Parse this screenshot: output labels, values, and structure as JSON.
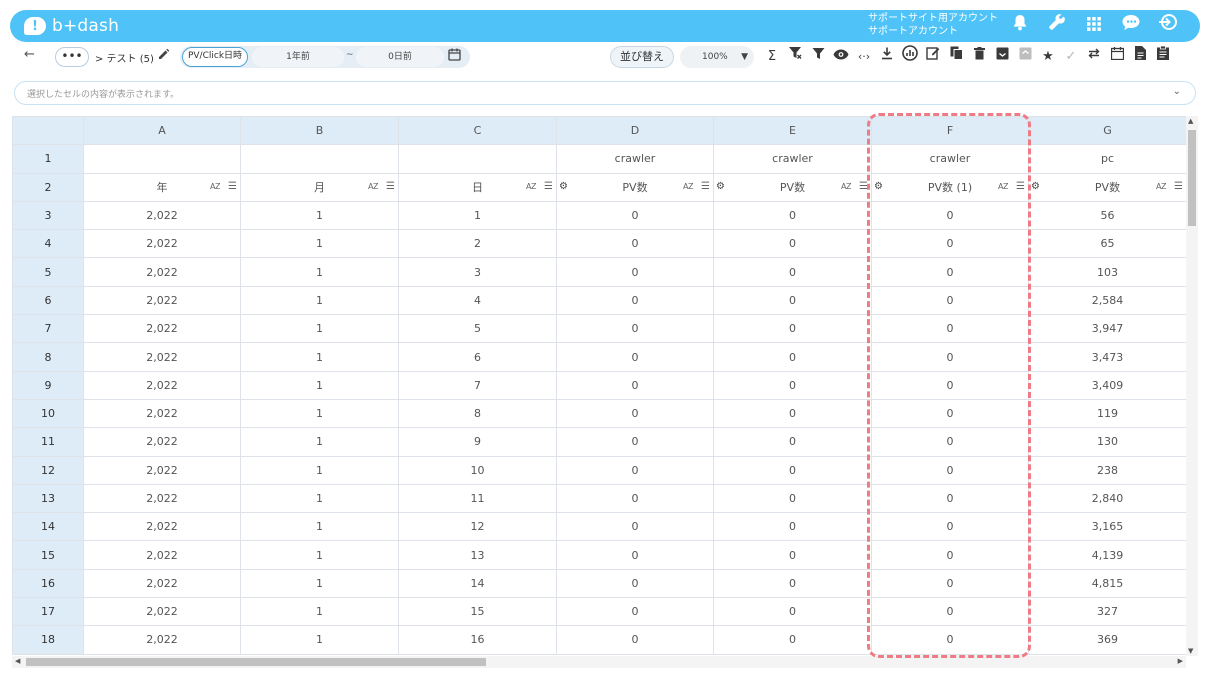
{
  "header": {
    "logo_mark": "!",
    "logo_text": "b+dash",
    "account_line1": "サポートサイト用アカウント",
    "account_line2": "サポートアカウント",
    "icons": [
      "bell-icon",
      "wrench-icon",
      "apps-grid-icon",
      "chat-icon",
      "logout-icon"
    ]
  },
  "toolbar": {
    "back": "←",
    "more": "•••",
    "breadcrumb": "> テスト (5)",
    "date_type": "PV/Click日時",
    "date_from": "1年前",
    "date_sep": "~",
    "date_to": "0日前",
    "sort_label": "並び替え",
    "zoom": "100%",
    "tool_icons": [
      "sum-icon",
      "filter-clear-icon",
      "filter-icon",
      "eye-icon",
      "code-icon",
      "download-icon",
      "chart-icon",
      "edit-note-icon",
      "copy-icon",
      "trash-icon",
      "archive-icon",
      "archive-disabled-icon",
      "star-icon",
      "approve-icon",
      "repeat-icon",
      "calendar-icon",
      "document-icon",
      "clipboard-icon"
    ]
  },
  "cellbar": {
    "placeholder": "選択したセルの内容が表示されます。"
  },
  "grid": {
    "columns": [
      "A",
      "B",
      "C",
      "D",
      "E",
      "F",
      "G"
    ],
    "group_row": [
      "",
      "",
      "",
      "crawler",
      "crawler",
      "crawler",
      "pc"
    ],
    "label_row": [
      "年",
      "月",
      "日",
      "PV数",
      "PV数",
      "PV数 (1)",
      "PV数"
    ],
    "az": "AZ",
    "row_numbers": [
      "1",
      "2",
      "3",
      "4",
      "5",
      "6",
      "7",
      "8",
      "9",
      "10",
      "11",
      "12",
      "13",
      "14",
      "15",
      "16",
      "17",
      "18"
    ],
    "rows": [
      [
        "2,022",
        "1",
        "1",
        "0",
        "0",
        "0",
        "56"
      ],
      [
        "2,022",
        "1",
        "2",
        "0",
        "0",
        "0",
        "65"
      ],
      [
        "2,022",
        "1",
        "3",
        "0",
        "0",
        "0",
        "103"
      ],
      [
        "2,022",
        "1",
        "4",
        "0",
        "0",
        "0",
        "2,584"
      ],
      [
        "2,022",
        "1",
        "5",
        "0",
        "0",
        "0",
        "3,947"
      ],
      [
        "2,022",
        "1",
        "6",
        "0",
        "0",
        "0",
        "3,473"
      ],
      [
        "2,022",
        "1",
        "7",
        "0",
        "0",
        "0",
        "3,409"
      ],
      [
        "2,022",
        "1",
        "8",
        "0",
        "0",
        "0",
        "119"
      ],
      [
        "2,022",
        "1",
        "9",
        "0",
        "0",
        "0",
        "130"
      ],
      [
        "2,022",
        "1",
        "10",
        "0",
        "0",
        "0",
        "238"
      ],
      [
        "2,022",
        "1",
        "11",
        "0",
        "0",
        "0",
        "2,840"
      ],
      [
        "2,022",
        "1",
        "12",
        "0",
        "0",
        "0",
        "3,165"
      ],
      [
        "2,022",
        "1",
        "13",
        "0",
        "0",
        "0",
        "4,139"
      ],
      [
        "2,022",
        "1",
        "14",
        "0",
        "0",
        "0",
        "4,815"
      ],
      [
        "2,022",
        "1",
        "15",
        "0",
        "0",
        "0",
        "327"
      ],
      [
        "2,022",
        "1",
        "16",
        "0",
        "0",
        "0",
        "369"
      ]
    ]
  },
  "highlight": {
    "column": "F",
    "color": "#ee7b86"
  }
}
